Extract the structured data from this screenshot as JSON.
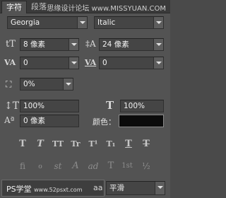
{
  "tabs": {
    "character": "字符",
    "paragraph": "段落"
  },
  "watermark": "思缘设计论坛 www.MISSYUAN.COM",
  "font": {
    "family": "Georgia",
    "style": "Italic"
  },
  "size": {
    "font_size": "8 像素",
    "leading": "24 像素"
  },
  "spacing": {
    "kerning": "0",
    "tracking": "0"
  },
  "tsume": "0%",
  "scale": {
    "vertical": "100%",
    "horizontal": "100%"
  },
  "baseline_shift": "0 像素",
  "color_label": "颜色：",
  "text_color": "#0b0b0b",
  "style_buttons": [
    "T",
    "T",
    "TT",
    "Tr",
    "T¹",
    "T₁",
    "T",
    "T"
  ],
  "opentype_buttons": [
    "fi",
    "ℴ",
    "st",
    "A",
    "ad",
    "T",
    "1st",
    "½"
  ],
  "bottom": {
    "input_text": "PS学堂",
    "watermark": "www.52psxt.com",
    "aa_label": "aa",
    "antialias": "平滑"
  }
}
